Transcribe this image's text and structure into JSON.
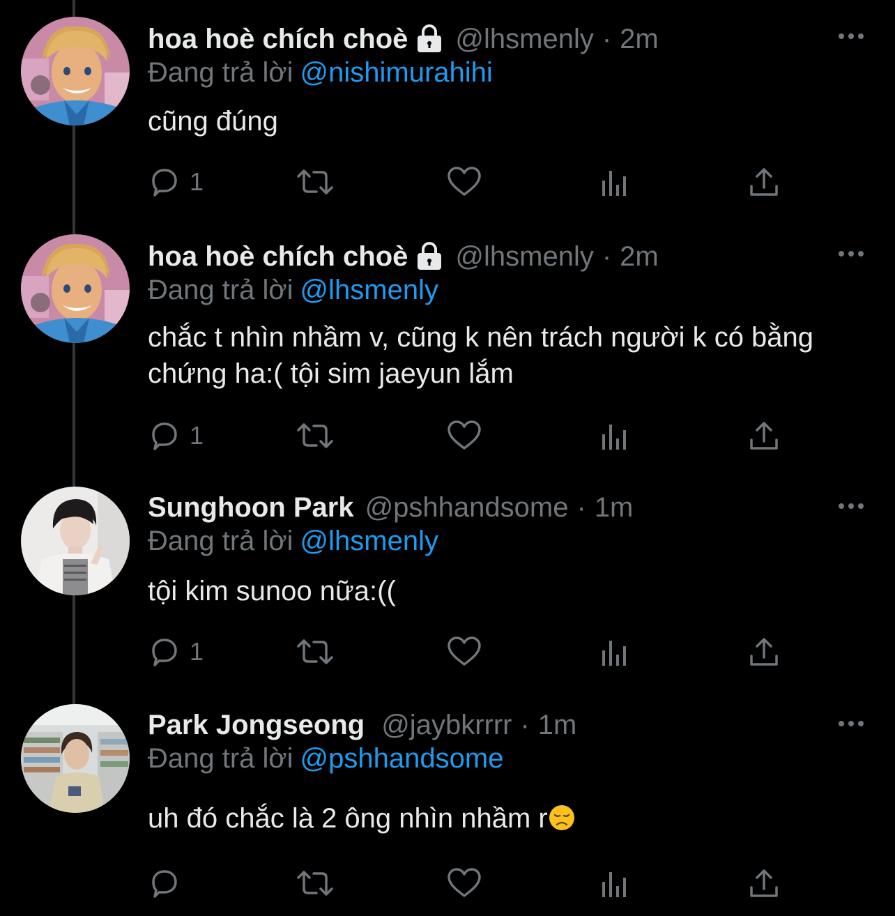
{
  "colors": {
    "background": "#000000",
    "primary_text": "#e7e9ea",
    "secondary_text": "#71767b",
    "mention": "#1d9bf0",
    "thread_line": "#333639"
  },
  "reply_prefix": "Đang trả lời",
  "tweets": [
    {
      "display_name": "hoa hoè chích choè",
      "protected_icon": "lock-icon",
      "handle": "@lhsmenly",
      "separator": "·",
      "time": "2m",
      "reply_to": "@nishimurahihi",
      "text": "cũng đúng",
      "reply_count": "1",
      "avatar": "cartoon-blond-man-avatar"
    },
    {
      "display_name": "hoa hoè chích choè",
      "protected_icon": "lock-icon",
      "handle": "@lhsmenly",
      "separator": "·",
      "time": "2m",
      "reply_to": "@lhsmenly",
      "text": "chắc t nhìn nhầm v, cũng k nên trách người k có bằng chứng ha:( tội sim jaeyun lắm",
      "reply_count": "1",
      "avatar": "cartoon-blond-man-avatar"
    },
    {
      "display_name": "Sunghoon Park",
      "handle": "@pshhandsome",
      "separator": "·",
      "time": "1m",
      "reply_to": "@lhsmenly",
      "text": "tội kim sunoo nữa:((",
      "reply_count": "1",
      "avatar": "person-photo-avatar"
    },
    {
      "display_name": "Park Jongseong",
      "handle": "@jaybkrrrr",
      "separator": "·",
      "time": "1m",
      "reply_to": "@pshhandsome",
      "text": "uh đó chắc là 2 ông nhìn nhầm r",
      "emoji": "disappointed-face-emoji",
      "reply_count": "",
      "avatar": "store-photo-avatar"
    }
  ],
  "icons": {
    "reply": "reply-icon",
    "retweet": "retweet-icon",
    "like": "like-heart-icon",
    "views": "views-bar-icon",
    "share": "share-icon",
    "more": "more-options-icon"
  }
}
